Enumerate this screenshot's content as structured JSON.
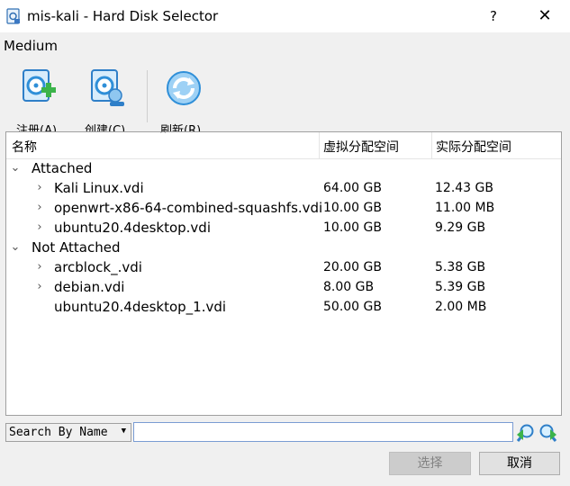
{
  "window": {
    "title": "mis-kali - Hard Disk Selector",
    "help_label": "?",
    "close_label": "✕"
  },
  "section_label": "Medium",
  "toolbar": {
    "add_label": "注册(A)",
    "create_label": "创建(C)",
    "refresh_label": "刷新(R)"
  },
  "tree": {
    "columns": [
      "名称",
      "虚拟分配空间",
      "实际分配空间"
    ],
    "sort_indicator": "^",
    "groups": [
      {
        "label": "Attached",
        "items": [
          {
            "name": "Kali Linux.vdi",
            "virtual": "64.00 GB",
            "actual": "12.43 GB",
            "expandable": true
          },
          {
            "name": "openwrt-x86-64-combined-squashfs.vdi",
            "virtual": "10.00 GB",
            "actual": "11.00 MB",
            "expandable": true
          },
          {
            "name": "ubuntu20.4desktop.vdi",
            "virtual": "10.00 GB",
            "actual": "9.29 GB",
            "expandable": true
          }
        ]
      },
      {
        "label": "Not Attached",
        "items": [
          {
            "name": "arcblock_.vdi",
            "virtual": "20.00 GB",
            "actual": "5.38 GB",
            "expandable": true
          },
          {
            "name": "debian.vdi",
            "virtual": "8.00 GB",
            "actual": "5.39 GB",
            "expandable": true
          },
          {
            "name": "ubuntu20.4desktop_1.vdi",
            "virtual": "50.00 GB",
            "actual": "2.00 MB",
            "expandable": false
          }
        ]
      }
    ]
  },
  "search": {
    "mode_label": "Search By Name",
    "value": "",
    "placeholder": ""
  },
  "buttons": {
    "select_label": "选择",
    "cancel_label": "取消"
  },
  "colors": {
    "accent_blue": "#2f8fd8",
    "add_green": "#3bb34a",
    "disabled_button": "#cccccc"
  }
}
